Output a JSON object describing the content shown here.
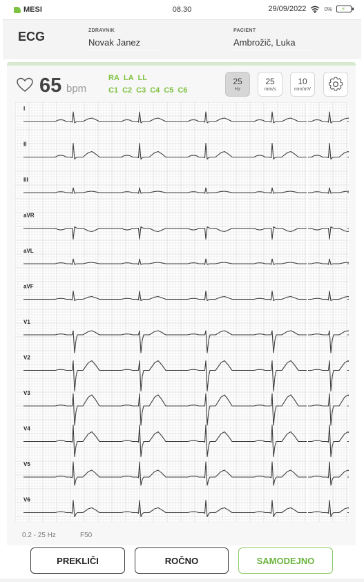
{
  "status_bar": {
    "carrier": "MESI",
    "time": "08.30",
    "date": "29/09/2022",
    "battery_percent": "0%",
    "icons": [
      "wifi-icon",
      "battery-charging-icon"
    ]
  },
  "header": {
    "title": "ECG",
    "doctor_label": "ZDRAVNIK",
    "doctor_name": "Novak Janez",
    "patient_label": "PACIENT",
    "patient_name": "Ambrožič, Luka"
  },
  "vitals": {
    "heart_rate": "65",
    "unit": "bpm",
    "icon": "heart-icon"
  },
  "electrodes": {
    "row1": [
      "RA",
      "LA",
      "LL"
    ],
    "row2": [
      "C1",
      "C2",
      "C3",
      "C4",
      "C5",
      "C6"
    ],
    "color": "#7ec241"
  },
  "controls": [
    {
      "value": "25",
      "unit": "Hz",
      "active": true
    },
    {
      "value": "25",
      "unit": "mm/s",
      "active": false
    },
    {
      "value": "10",
      "unit": "mm/mV",
      "active": false
    }
  ],
  "settings_icon": "gear-icon",
  "ecg": {
    "leads": [
      "I",
      "II",
      "III",
      "aVR",
      "aVL",
      "aVF",
      "V1",
      "V2",
      "V3",
      "V4",
      "V5",
      "V6"
    ]
  },
  "footer": {
    "filter_range": "0.2 - 25 Hz",
    "filter_notch": "F50",
    "buttons": {
      "cancel": "PREKLIČI",
      "manual": "ROČNO",
      "auto": "SAMODEJNO"
    }
  },
  "colors": {
    "accent": "#7ec241",
    "grid_major": "#c8c8c8",
    "grid_minor": "#e6e6e6",
    "trace": "#3d3d3d"
  }
}
